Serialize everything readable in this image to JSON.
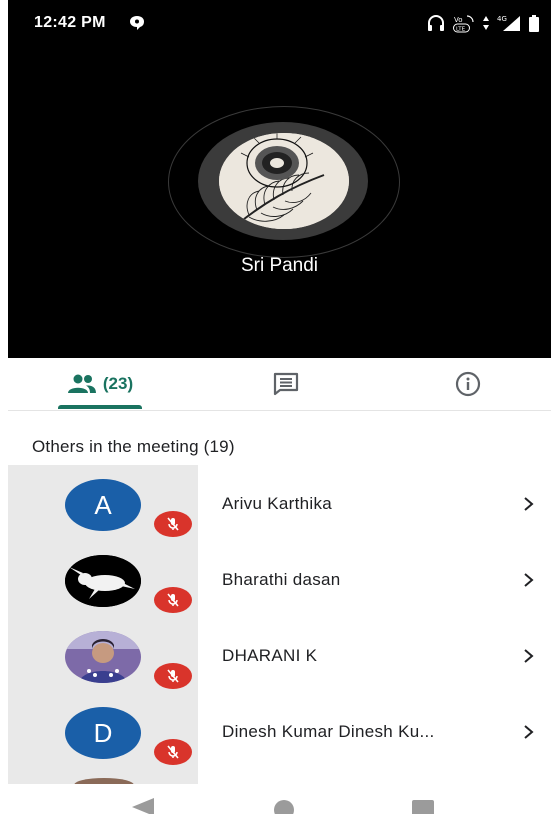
{
  "status_bar": {
    "time": "12:42 PM",
    "icons": [
      "message-icon",
      "headphones-icon",
      "volte-icon",
      "data-arrows-icon",
      "4g-icon",
      "signal-icon",
      "battery-icon"
    ]
  },
  "speaker": {
    "name": "Sri Pandi",
    "avatar": "peacock-feather-image"
  },
  "tabs": {
    "people_label": "(23)",
    "people_icon": "people-icon",
    "chat_icon": "chat-icon",
    "info_icon": "info-icon",
    "active_color": "#1a7360"
  },
  "participants": {
    "section_title": "Others in the meeting (19)",
    "items": [
      {
        "name": "Arivu Karthika",
        "avatar_letter": "A",
        "avatar_color": "#1a5fa8",
        "muted": true
      },
      {
        "name": "Bharathi dasan",
        "avatar_letter": "",
        "avatar_image": "rabbit-photo",
        "muted": true
      },
      {
        "name": "DHARANI K",
        "avatar_letter": "",
        "avatar_image": "person-photo",
        "muted": true
      },
      {
        "name": "Dinesh Kumar Dinesh Ku...",
        "avatar_letter": "D",
        "avatar_color": "#1a5fa8",
        "muted": true
      }
    ]
  },
  "colors": {
    "mute_badge": "#d9342b",
    "stage_background": "#000000"
  },
  "nav_bar": {
    "icons": [
      "back-icon",
      "home-icon",
      "recents-icon"
    ]
  }
}
